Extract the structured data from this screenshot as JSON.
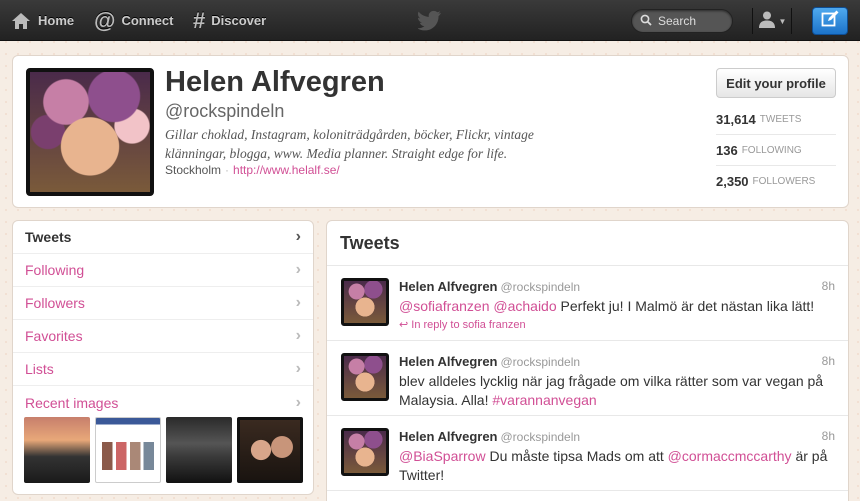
{
  "topbar": {
    "home": "Home",
    "connect": "Connect",
    "discover": "Discover",
    "search_placeholder": "Search"
  },
  "profile": {
    "name": "Helen Alfvegren",
    "screen_name": "@rockspindeln",
    "bio": "Gillar choklad, Instagram, koloniträdgården, böcker, Flickr, vintage klänningar, blogga, www. Media planner. Straight edge for life.",
    "location": "Stockholm",
    "url": "http://www.helalf.se/",
    "edit_button": "Edit your profile",
    "stats": [
      {
        "count": "31,614",
        "label": "TWEETS"
      },
      {
        "count": "136",
        "label": "FOLLOWING"
      },
      {
        "count": "2,350",
        "label": "FOLLOWERS"
      }
    ]
  },
  "sidenav": {
    "items": [
      "Tweets",
      "Following",
      "Followers",
      "Favorites",
      "Lists",
      "Recent images"
    ]
  },
  "timeline": {
    "title": "Tweets",
    "tweets": [
      {
        "name": "Helen Alfvegren",
        "handle": "@rockspindeln",
        "time": "8h",
        "mention1": "@sofiafranzen",
        "mention2": "@achaido",
        "text": "Perfekt ju! I Malmö är det nästan lika lätt!",
        "reply": "In reply to sofia franzen"
      },
      {
        "name": "Helen Alfvegren",
        "handle": "@rockspindeln",
        "time": "8h",
        "text": "blev alldeles lycklig när jag frågade om vilka rätter som var vegan på Malaysia. Alla!",
        "hashtag": "#varannanvegan"
      },
      {
        "name": "Helen Alfvegren",
        "handle": "@rockspindeln",
        "time": "8h",
        "mention1": "@BiaSparrow",
        "text_a": "Du måste tipsa Mads om att",
        "mention2": "@cormaccmccarthy",
        "text_b": "är på Twitter!"
      }
    ]
  },
  "colors": {
    "link": "#d14f95",
    "topbar": "#2a2a2a",
    "compose": "#2a86dc"
  }
}
